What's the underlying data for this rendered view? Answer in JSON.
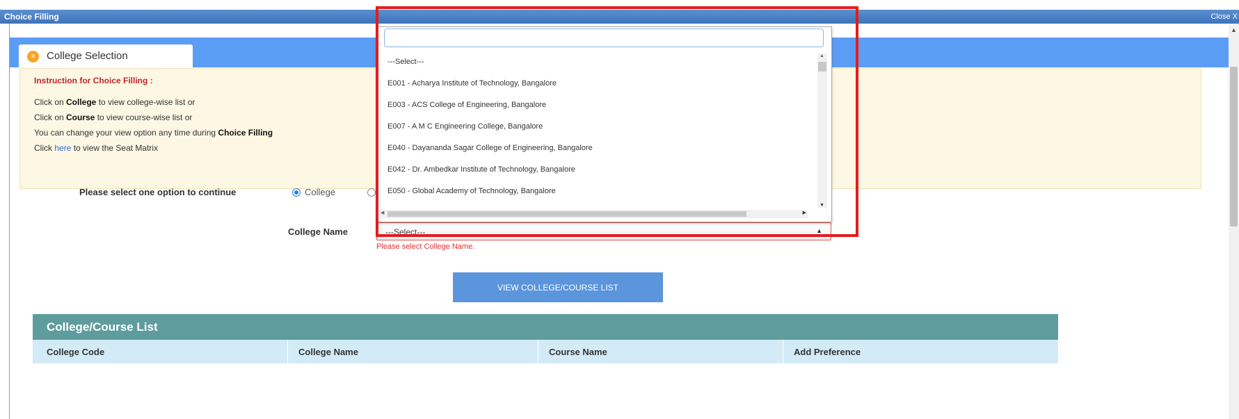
{
  "window": {
    "title": "Choice Filling",
    "close_label": "Close X"
  },
  "tab": {
    "icon": "list-icon",
    "label": "College Selection"
  },
  "instructions": {
    "heading": "Instruction for Choice Filling :",
    "line1_pre": "Click on ",
    "line1_bold": "College",
    "line1_post": " to view college-wise list or",
    "line2_pre": "Click on ",
    "line2_bold": "Course",
    "line2_post": " to view course-wise list or",
    "line3_pre": "You can change your view option any time during ",
    "line3_bold": "Choice Filling",
    "line4_pre": "Click ",
    "line4_link": "here",
    "line4_post": " to view the Seat Matrix"
  },
  "options": {
    "prompt": "Please select one option to continue",
    "college_label": "College",
    "selected": "College"
  },
  "college_select": {
    "label": "College Name",
    "value": "---Select---",
    "error": "Please select College Name.",
    "search_value": "",
    "options": [
      "---Select---",
      "E001 - Acharya Institute of Technology, Bangalore",
      "E003 - ACS College of Engineering, Bangalore",
      "E007 - A M C Engineering College, Bangalore",
      "E040 - Dayananda Sagar College of Engineering, Bangalore",
      "E042 - Dr. Ambedkar Institute of Technology, Bangalore",
      "E050 - Global Academy of Technology, Bangalore"
    ]
  },
  "view_button": "VIEW COLLEGE/COURSE LIST",
  "list": {
    "title": "College/Course List",
    "columns": [
      "College Code",
      "College Name",
      "Course Name",
      "Add Preference"
    ]
  },
  "colors": {
    "highlight": "#e61c1c",
    "tabbar": "#5b9cf5",
    "list_header": "#5f9c9e",
    "button": "#5b95db"
  }
}
